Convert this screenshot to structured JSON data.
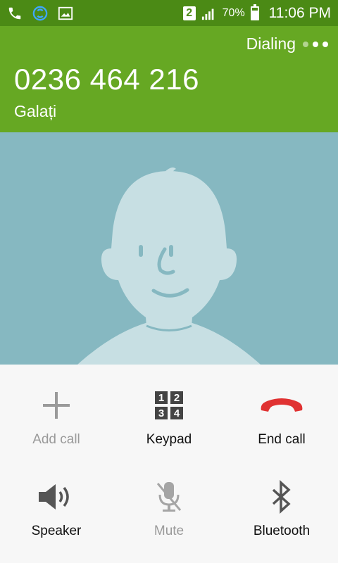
{
  "status_bar": {
    "icons": [
      "phone-icon",
      "sync-icon",
      "gallery-icon"
    ],
    "sim_slot": "2",
    "battery_percent": "70%",
    "battery_level": 0.7,
    "time": "11:06 PM"
  },
  "call": {
    "state": "Dialing",
    "number": "0236 464 216",
    "location": "Galați"
  },
  "colors": {
    "status_bar_bg": "#4b8a15",
    "header_bg": "#66a823",
    "photo_bg": "#86b8c1",
    "end_call_red": "#e03232"
  },
  "controls": {
    "add_call": "Add call",
    "keypad": "Keypad",
    "keypad_digits": [
      "1",
      "2",
      "3",
      "4"
    ],
    "end_call": "End call",
    "speaker": "Speaker",
    "mute": "Mute",
    "bluetooth": "Bluetooth"
  }
}
